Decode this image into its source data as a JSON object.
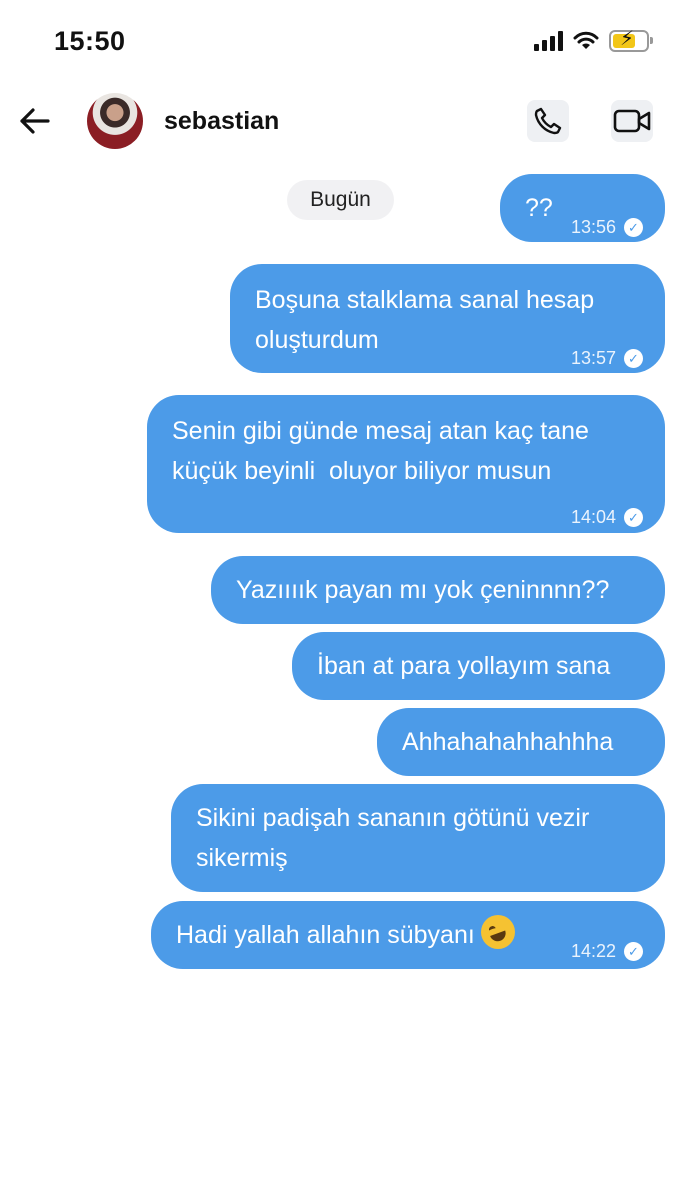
{
  "status_bar": {
    "time": "15:50"
  },
  "header": {
    "username": "sebastian"
  },
  "chat": {
    "day_label": "Bugün",
    "messages": [
      {
        "text": "??",
        "time": "13:56",
        "seen": true
      },
      {
        "text": "Boşuna stalklama sanal hesap oluşturdum",
        "time": "13:57",
        "seen": true
      },
      {
        "text": "Senin gibi günde mesaj atan kaç tane küçük beyinli  oluyor biliyor musun",
        "time": "14:04",
        "seen": true
      },
      {
        "text": "Yazıııık payan mı yok çeninnnn??"
      },
      {
        "text": "İban at para yollayım sana"
      },
      {
        "text": "Ahhahahahhahhha"
      },
      {
        "text": "Sikini padişah sananın götünü vezir sikermiş"
      },
      {
        "text": "Hadi yallah allahın sübyanı",
        "emoji": "rolling-on-floor-laughing",
        "time": "14:22",
        "seen": true
      }
    ]
  },
  "colors": {
    "bubble": "#4c9be8",
    "chip": "#f1f1f3"
  }
}
